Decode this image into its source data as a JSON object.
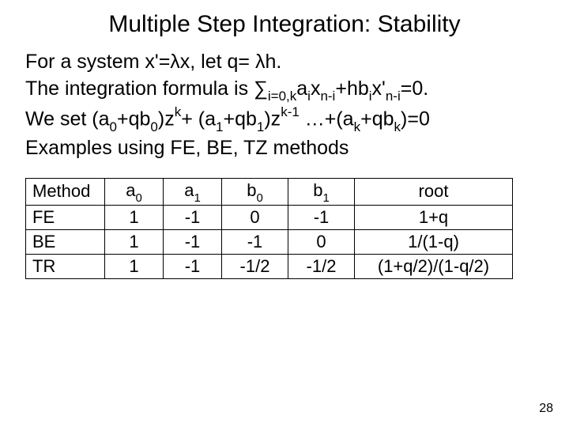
{
  "title": "Multiple Step Integration: Stability",
  "body": {
    "line1_pre": "For a system x'=λx, let q= λh.",
    "line2_pre": "The integration formula is ",
    "line2_sum_base": "∑",
    "line2_sum_sub": "i=0,k",
    "line2_a": "a",
    "line2_a_sub": "i",
    "line2_x1": "x",
    "line2_x1_sub": "n-i",
    "line2_plus": "+hb",
    "line2_b_sub": "i",
    "line2_x2": "x'",
    "line2_x2_sub": "n-i",
    "line2_tail": "=0.",
    "line3_pre": "We set (a",
    "line3_a0sub": "0",
    "line3_mid1": "+qb",
    "line3_b0sub": "0",
    "line3_mid2": ")z",
    "line3_k": "k",
    "line3_plus": "+ (a",
    "line3_a1sub": "1",
    "line3_mid3": "+qb",
    "line3_b1sub": "1",
    "line3_mid4": ")z",
    "line3_k1": "k-1",
    "line3_mid5": " …+(a",
    "line3_aksub": "k",
    "line3_mid6": "+qb",
    "line3_bksub": "k",
    "line3_tail": ")=0",
    "line4": "Examples using FE, BE, TZ methods"
  },
  "table": {
    "headers": {
      "method": "Method",
      "a0_pre": "a",
      "a0_sub": "0",
      "a1_pre": "a",
      "a1_sub": "1",
      "b0_pre": "b",
      "b0_sub": "0",
      "b1_pre": "b",
      "b1_sub": "1",
      "root": "root"
    },
    "rows": [
      {
        "method": "FE",
        "a0": "1",
        "a1": "-1",
        "b0": "0",
        "b1": "-1",
        "root": "1+q"
      },
      {
        "method": "BE",
        "a0": "1",
        "a1": "-1",
        "b0": "-1",
        "b1": "0",
        "root": "1/(1-q)"
      },
      {
        "method": "TR",
        "a0": "1",
        "a1": "-1",
        "b0": "-1/2",
        "b1": "-1/2",
        "root": "(1+q/2)/(1-q/2)"
      }
    ]
  },
  "page_number": "28"
}
